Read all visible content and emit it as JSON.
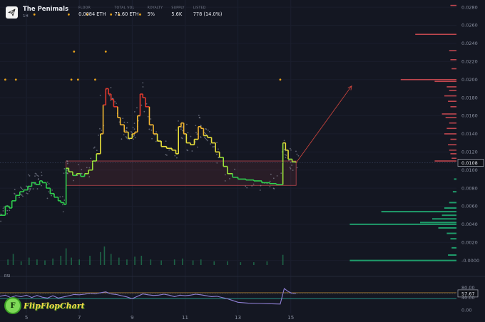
{
  "header": {
    "title": "The Penimals",
    "timeframe": "1H",
    "stats": [
      {
        "label": "FLOOR",
        "value": "0.0084 ETH"
      },
      {
        "label": "TOTAL VOL",
        "value": "71.60 ETH"
      },
      {
        "label": "ROYALTY",
        "value": "5%"
      },
      {
        "label": "SUPPLY",
        "value": "5.6K"
      },
      {
        "label": "LISTED",
        "value": "778 (14.0%)"
      }
    ]
  },
  "brand": {
    "icon_letter": "F",
    "text": "FlipFlopChart"
  },
  "rsi": {
    "label": "RSI",
    "value_tag": "57.67",
    "upper": 60,
    "lower": 40,
    "ticks": [
      "80.00",
      "40.00",
      "0.00"
    ]
  },
  "colors": {
    "background": "#141722",
    "bid": "#1f9d6b",
    "ask": "#c0474f",
    "box": "#b8454d",
    "rsi_line": "#8f7fd4",
    "rsi_upper": "#d8a23a",
    "rsi_lower": "#2bb3a0",
    "dot": "#e8a21a"
  },
  "chart_data": {
    "type": "line",
    "title": "",
    "x_ticks": [
      "5",
      "7",
      "9",
      "11",
      "13",
      "15"
    ],
    "y_ticks": [
      "0.0280",
      "0.0260",
      "0.0240",
      "0.0220",
      "0.0200",
      "0.0180",
      "0.0160",
      "0.0140",
      "0.0120",
      "0.0100",
      "0.0080",
      "0.0060",
      "0.0040",
      "0.0020",
      "-0.0000"
    ],
    "current_price_tag": "0.0108",
    "ylim": [
      -0.0005,
      0.0288
    ],
    "xlim": [
      4.0,
      15.6
    ],
    "floor_series": [
      {
        "x": 4.0,
        "y": 0.005
      },
      {
        "x": 4.2,
        "y": 0.006
      },
      {
        "x": 4.35,
        "y": 0.0058
      },
      {
        "x": 4.45,
        "y": 0.0066
      },
      {
        "x": 4.6,
        "y": 0.0072
      },
      {
        "x": 4.75,
        "y": 0.0076
      },
      {
        "x": 4.9,
        "y": 0.0078
      },
      {
        "x": 5.05,
        "y": 0.0082
      },
      {
        "x": 5.2,
        "y": 0.0086
      },
      {
        "x": 5.35,
        "y": 0.0084
      },
      {
        "x": 5.5,
        "y": 0.0088
      },
      {
        "x": 5.6,
        "y": 0.0086
      },
      {
        "x": 5.75,
        "y": 0.008
      },
      {
        "x": 5.9,
        "y": 0.0074
      },
      {
        "x": 6.05,
        "y": 0.007
      },
      {
        "x": 6.2,
        "y": 0.0066
      },
      {
        "x": 6.3,
        "y": 0.0064
      },
      {
        "x": 6.42,
        "y": 0.0062
      },
      {
        "x": 6.5,
        "y": 0.0102
      },
      {
        "x": 6.6,
        "y": 0.0098
      },
      {
        "x": 6.75,
        "y": 0.0094
      },
      {
        "x": 6.9,
        "y": 0.0096
      },
      {
        "x": 7.05,
        "y": 0.0093
      },
      {
        "x": 7.2,
        "y": 0.0096
      },
      {
        "x": 7.35,
        "y": 0.01
      },
      {
        "x": 7.5,
        "y": 0.011
      },
      {
        "x": 7.65,
        "y": 0.0118
      },
      {
        "x": 7.8,
        "y": 0.014
      },
      {
        "x": 7.9,
        "y": 0.0172
      },
      {
        "x": 8.0,
        "y": 0.019
      },
      {
        "x": 8.1,
        "y": 0.0184
      },
      {
        "x": 8.2,
        "y": 0.0178
      },
      {
        "x": 8.3,
        "y": 0.017
      },
      {
        "x": 8.45,
        "y": 0.0158
      },
      {
        "x": 8.55,
        "y": 0.015
      },
      {
        "x": 8.7,
        "y": 0.0142
      },
      {
        "x": 8.85,
        "y": 0.0135
      },
      {
        "x": 9.0,
        "y": 0.014
      },
      {
        "x": 9.1,
        "y": 0.0142
      },
      {
        "x": 9.2,
        "y": 0.016
      },
      {
        "x": 9.3,
        "y": 0.0184
      },
      {
        "x": 9.4,
        "y": 0.018
      },
      {
        "x": 9.5,
        "y": 0.017
      },
      {
        "x": 9.65,
        "y": 0.015
      },
      {
        "x": 9.8,
        "y": 0.014
      },
      {
        "x": 9.95,
        "y": 0.0132
      },
      {
        "x": 10.1,
        "y": 0.0126
      },
      {
        "x": 10.3,
        "y": 0.0124
      },
      {
        "x": 10.5,
        "y": 0.0122
      },
      {
        "x": 10.65,
        "y": 0.0118
      },
      {
        "x": 10.75,
        "y": 0.0148
      },
      {
        "x": 10.85,
        "y": 0.0152
      },
      {
        "x": 10.95,
        "y": 0.014
      },
      {
        "x": 11.05,
        "y": 0.013
      },
      {
        "x": 11.2,
        "y": 0.0128
      },
      {
        "x": 11.35,
        "y": 0.0134
      },
      {
        "x": 11.5,
        "y": 0.0148
      },
      {
        "x": 11.6,
        "y": 0.0146
      },
      {
        "x": 11.7,
        "y": 0.0138
      },
      {
        "x": 11.85,
        "y": 0.0136
      },
      {
        "x": 12.0,
        "y": 0.013
      },
      {
        "x": 12.15,
        "y": 0.012
      },
      {
        "x": 12.3,
        "y": 0.0114
      },
      {
        "x": 12.45,
        "y": 0.0104
      },
      {
        "x": 12.6,
        "y": 0.0096
      },
      {
        "x": 12.8,
        "y": 0.0092
      },
      {
        "x": 13.0,
        "y": 0.009
      },
      {
        "x": 13.3,
        "y": 0.0089
      },
      {
        "x": 13.6,
        "y": 0.0088
      },
      {
        "x": 13.9,
        "y": 0.0086
      },
      {
        "x": 14.2,
        "y": 0.0085
      },
      {
        "x": 14.45,
        "y": 0.0084
      },
      {
        "x": 14.6,
        "y": 0.0084
      },
      {
        "x": 14.7,
        "y": 0.013
      },
      {
        "x": 14.8,
        "y": 0.0122
      },
      {
        "x": 14.9,
        "y": 0.0112
      },
      {
        "x": 15.05,
        "y": 0.0109
      },
      {
        "x": 15.2,
        "y": 0.0108
      }
    ],
    "range_box": {
      "x": [
        6.5,
        15.2
      ],
      "y": [
        0.0083,
        0.011
      ]
    },
    "projection": {
      "from": {
        "x": 15.2,
        "y": 0.0108
      },
      "to": {
        "x": 17.3,
        "y": 0.0193
      }
    },
    "signal_dots": [
      {
        "x": 5.3,
        "y": 0.0272
      },
      {
        "x": 6.6,
        "y": 0.0272
      },
      {
        "x": 7.3,
        "y": 0.0272
      },
      {
        "x": 8.2,
        "y": 0.0272
      },
      {
        "x": 8.5,
        "y": 0.0272
      },
      {
        "x": 9.3,
        "y": 0.0272
      },
      {
        "x": 6.8,
        "y": 0.0231
      },
      {
        "x": 8.0,
        "y": 0.0231
      },
      {
        "x": 4.2,
        "y": 0.02
      },
      {
        "x": 4.6,
        "y": 0.02
      },
      {
        "x": 6.7,
        "y": 0.02
      },
      {
        "x": 6.95,
        "y": 0.02
      },
      {
        "x": 7.6,
        "y": 0.02
      },
      {
        "x": 14.6,
        "y": 0.02
      }
    ],
    "ask_depth": [
      {
        "y": 0.029,
        "v": 0.08
      },
      {
        "y": 0.0282,
        "v": 0.05
      },
      {
        "y": 0.025,
        "v": 0.34
      },
      {
        "y": 0.0232,
        "v": 0.06
      },
      {
        "y": 0.0222,
        "v": 0.05
      },
      {
        "y": 0.0212,
        "v": 0.04
      },
      {
        "y": 0.02,
        "v": 0.46
      },
      {
        "y": 0.0198,
        "v": 0.18
      },
      {
        "y": 0.0192,
        "v": 0.08
      },
      {
        "y": 0.0188,
        "v": 0.06
      },
      {
        "y": 0.0182,
        "v": 0.1
      },
      {
        "y": 0.0176,
        "v": 0.07
      },
      {
        "y": 0.017,
        "v": 0.05
      },
      {
        "y": 0.0162,
        "v": 0.12
      },
      {
        "y": 0.0158,
        "v": 0.09
      },
      {
        "y": 0.0152,
        "v": 0.06
      },
      {
        "y": 0.0146,
        "v": 0.08
      },
      {
        "y": 0.014,
        "v": 0.1
      },
      {
        "y": 0.0134,
        "v": 0.05
      },
      {
        "y": 0.0128,
        "v": 0.07
      },
      {
        "y": 0.0122,
        "v": 0.06
      },
      {
        "y": 0.0118,
        "v": 0.05
      },
      {
        "y": 0.0113,
        "v": 0.04
      },
      {
        "y": 0.011,
        "v": 0.18
      }
    ],
    "bid_depth": [
      {
        "y": 0.009,
        "v": 0.02
      },
      {
        "y": 0.0076,
        "v": 0.03
      },
      {
        "y": 0.0064,
        "v": 0.06
      },
      {
        "y": 0.0058,
        "v": 0.1
      },
      {
        "y": 0.0054,
        "v": 0.62
      },
      {
        "y": 0.005,
        "v": 0.12
      },
      {
        "y": 0.0046,
        "v": 0.2
      },
      {
        "y": 0.0042,
        "v": 0.3
      },
      {
        "y": 0.004,
        "v": 0.88
      },
      {
        "y": 0.0036,
        "v": 0.15
      },
      {
        "y": 0.003,
        "v": 0.08
      },
      {
        "y": 0.0024,
        "v": 0.05
      },
      {
        "y": 0.0014,
        "v": 0.04
      },
      {
        "y": 0.0006,
        "v": 0.07
      },
      {
        "y": 0.0,
        "v": 0.88
      }
    ],
    "rsi_series": [
      {
        "x": 4.0,
        "y": 48
      },
      {
        "x": 4.2,
        "y": 52
      },
      {
        "x": 4.4,
        "y": 44
      },
      {
        "x": 4.6,
        "y": 50
      },
      {
        "x": 4.8,
        "y": 47
      },
      {
        "x": 5.0,
        "y": 52
      },
      {
        "x": 5.2,
        "y": 44
      },
      {
        "x": 5.4,
        "y": 51
      },
      {
        "x": 5.6,
        "y": 45
      },
      {
        "x": 5.8,
        "y": 42
      },
      {
        "x": 6.0,
        "y": 50
      },
      {
        "x": 6.2,
        "y": 42
      },
      {
        "x": 6.4,
        "y": 46
      },
      {
        "x": 6.6,
        "y": 50
      },
      {
        "x": 6.8,
        "y": 54
      },
      {
        "x": 7.0,
        "y": 53
      },
      {
        "x": 7.2,
        "y": 55
      },
      {
        "x": 7.4,
        "y": 58
      },
      {
        "x": 7.6,
        "y": 56
      },
      {
        "x": 7.8,
        "y": 60
      },
      {
        "x": 8.0,
        "y": 63
      },
      {
        "x": 8.2,
        "y": 56
      },
      {
        "x": 8.4,
        "y": 54
      },
      {
        "x": 8.6,
        "y": 50
      },
      {
        "x": 8.8,
        "y": 46
      },
      {
        "x": 9.0,
        "y": 40
      },
      {
        "x": 9.2,
        "y": 48
      },
      {
        "x": 9.4,
        "y": 56
      },
      {
        "x": 9.6,
        "y": 53
      },
      {
        "x": 9.8,
        "y": 51
      },
      {
        "x": 10.0,
        "y": 52
      },
      {
        "x": 10.2,
        "y": 55
      },
      {
        "x": 10.4,
        "y": 52
      },
      {
        "x": 10.6,
        "y": 47
      },
      {
        "x": 10.8,
        "y": 52
      },
      {
        "x": 11.0,
        "y": 50
      },
      {
        "x": 11.2,
        "y": 52
      },
      {
        "x": 11.4,
        "y": 55
      },
      {
        "x": 11.6,
        "y": 53
      },
      {
        "x": 11.8,
        "y": 50
      },
      {
        "x": 12.0,
        "y": 47
      },
      {
        "x": 12.2,
        "y": 48
      },
      {
        "x": 12.4,
        "y": 44
      },
      {
        "x": 12.6,
        "y": 40
      },
      {
        "x": 12.8,
        "y": 34
      },
      {
        "x": 13.0,
        "y": 28
      },
      {
        "x": 13.4,
        "y": 25
      },
      {
        "x": 13.8,
        "y": 24
      },
      {
        "x": 14.2,
        "y": 23
      },
      {
        "x": 14.6,
        "y": 22
      },
      {
        "x": 14.75,
        "y": 74
      },
      {
        "x": 14.9,
        "y": 64
      },
      {
        "x": 15.05,
        "y": 58
      },
      {
        "x": 15.2,
        "y": 57.67
      }
    ],
    "volume_bars": [
      {
        "x": 4.3,
        "v": 0.3
      },
      {
        "x": 4.5,
        "v": 0.6
      },
      {
        "x": 4.8,
        "v": 0.2
      },
      {
        "x": 5.1,
        "v": 0.4
      },
      {
        "x": 5.4,
        "v": 0.3
      },
      {
        "x": 5.7,
        "v": 0.25
      },
      {
        "x": 6.0,
        "v": 0.35
      },
      {
        "x": 6.3,
        "v": 0.5
      },
      {
        "x": 6.5,
        "v": 0.9
      },
      {
        "x": 6.7,
        "v": 0.4
      },
      {
        "x": 7.0,
        "v": 0.3
      },
      {
        "x": 7.4,
        "v": 0.5
      },
      {
        "x": 7.8,
        "v": 0.7
      },
      {
        "x": 7.95,
        "v": 1.0
      },
      {
        "x": 8.2,
        "v": 0.6
      },
      {
        "x": 8.5,
        "v": 0.4
      },
      {
        "x": 8.8,
        "v": 0.3
      },
      {
        "x": 9.1,
        "v": 0.45
      },
      {
        "x": 9.35,
        "v": 0.5
      },
      {
        "x": 9.7,
        "v": 0.3
      },
      {
        "x": 10.1,
        "v": 0.25
      },
      {
        "x": 10.6,
        "v": 0.3
      },
      {
        "x": 10.9,
        "v": 0.35
      },
      {
        "x": 11.3,
        "v": 0.25
      },
      {
        "x": 11.6,
        "v": 0.3
      },
      {
        "x": 12.1,
        "v": 0.2
      },
      {
        "x": 12.6,
        "v": 0.2
      },
      {
        "x": 13.1,
        "v": 0.15
      },
      {
        "x": 13.6,
        "v": 0.15
      },
      {
        "x": 14.1,
        "v": 0.2
      },
      {
        "x": 14.7,
        "v": 0.55
      }
    ]
  }
}
